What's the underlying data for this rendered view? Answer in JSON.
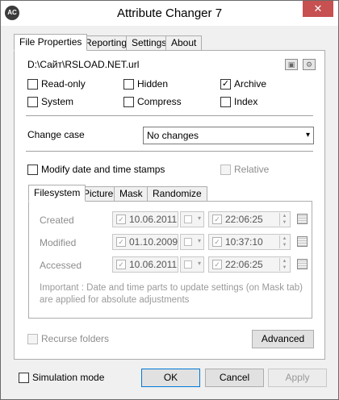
{
  "window": {
    "title": "Attribute Changer 7",
    "app_icon_text": "AC",
    "close_glyph": "✕"
  },
  "tabs": {
    "items": [
      "File Properties",
      "Reporting",
      "Settings",
      "About"
    ],
    "active": "File Properties"
  },
  "file": {
    "path": "D:\\Сайт\\RSLOAD.NET.url",
    "icon1": "disk-icon",
    "icon2": "gear-icon"
  },
  "attributes": {
    "read_only": {
      "label": "Read-only",
      "checked": false
    },
    "hidden": {
      "label": "Hidden",
      "checked": false
    },
    "archive": {
      "label": "Archive",
      "checked": true
    },
    "system": {
      "label": "System",
      "checked": false
    },
    "compress": {
      "label": "Compress",
      "checked": false
    },
    "index": {
      "label": "Index",
      "checked": false
    }
  },
  "change_case": {
    "label": "Change case",
    "value": "No changes"
  },
  "modify_dates": {
    "label": "Modify date and time stamps",
    "checked": false,
    "relative_label": "Relative",
    "relative_checked": false
  },
  "subtabs": {
    "items": [
      "Filesystem",
      "Picture",
      "Mask",
      "Randomize"
    ],
    "active": "Filesystem"
  },
  "timestamps": [
    {
      "label": "Created",
      "date": "10.06.2011",
      "time": "22:06:25"
    },
    {
      "label": "Modified",
      "date": "01.10.2009",
      "time": "10:37:10"
    },
    {
      "label": "Accessed",
      "date": "10.06.2011",
      "time": "22:06:25"
    }
  ],
  "important_note": "Important : Date and time parts to update settings (on Mask tab) are applied for absolute adjustments",
  "recurse": {
    "label": "Recurse folders",
    "checked": false
  },
  "advanced_button": "Advanced",
  "simulation": {
    "label": "Simulation mode",
    "checked": false
  },
  "buttons": {
    "ok": "OK",
    "cancel": "Cancel",
    "apply": "Apply"
  },
  "glyphs": {
    "check": "✓",
    "combo_arrow": "▾",
    "spin_up": "▲",
    "spin_down": "▼"
  }
}
